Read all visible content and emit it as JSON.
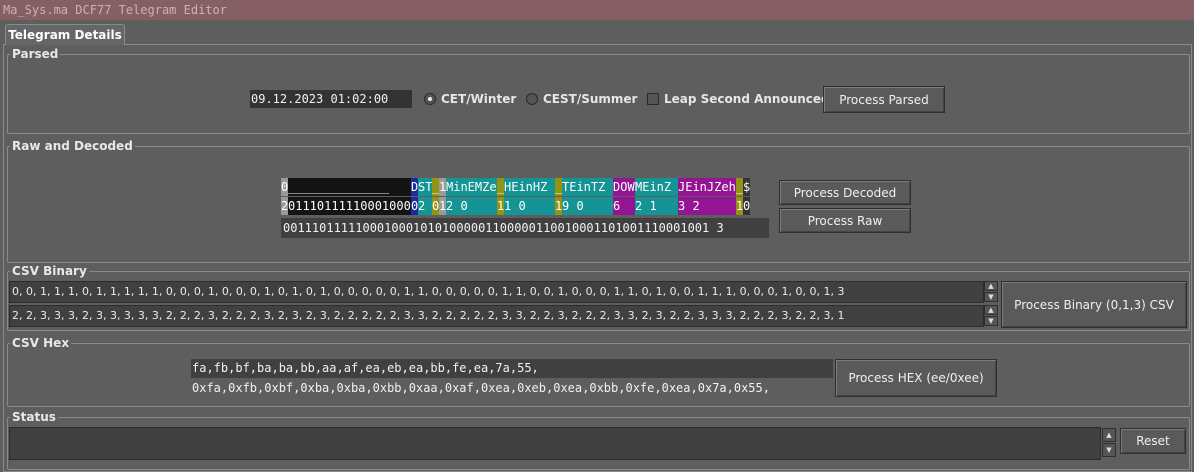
{
  "window": {
    "title": "Ma_Sys.ma DCF77 Telegram Editor"
  },
  "tabs": [
    {
      "label": "Telegram Details"
    }
  ],
  "parsed": {
    "title": "Parsed",
    "datetime_value": "09.12.2023 01:02:00",
    "radio_cet": "CET/Winter",
    "radio_cest": "CEST/Summer",
    "selected": "CET/Winter",
    "leap_label": "Leap Second Announced",
    "leap_checked": false,
    "process_button": "Process Parsed"
  },
  "raw_decoded": {
    "title": "Raw and Decoded",
    "decoded_button": "Process Decoded",
    "raw_button": "Process Raw",
    "segments": [
      {
        "h": "0",
        "v": "2",
        "color": "#9a9a9a"
      },
      {
        "h": "______________",
        "v": "01110111110001000",
        "color": "#141414"
      },
      {
        "h": "D",
        "v": "0",
        "color": "#1c2c9c"
      },
      {
        "h": "ST",
        "v": "2",
        "color": "#149494"
      },
      {
        "h": "_",
        "v": "0",
        "color": "#949414"
      },
      {
        "h": "1",
        "v": "1",
        "color": "#9a9a9a"
      },
      {
        "h": "MinEMZe",
        "v": "2     0",
        "color": "#149494"
      },
      {
        "h": "_",
        "v": "1",
        "color": "#949414"
      },
      {
        "h": "HEinHZ",
        "v": "1     0",
        "color": "#149494"
      },
      {
        "h": "_",
        "v": "1",
        "color": "#949414"
      },
      {
        "h": "TEinTZ",
        "v": "9     0",
        "color": "#149494"
      },
      {
        "h": "DOW",
        "v": "6",
        "color": "#941494"
      },
      {
        "h": "MEinZ",
        "v": "2    1",
        "color": "#149494"
      },
      {
        "h": "JEinJZeh",
        "v": "3   2",
        "color": "#941494"
      },
      {
        "h": "_",
        "v": "1",
        "color": "#949414"
      },
      {
        "h": "$",
        "v": "0",
        "color": "#333333"
      }
    ],
    "raw_bits": "00111011111000100010101000001100000110010001101001110001001 3"
  },
  "csv_binary": {
    "title": "CSV Binary",
    "line1": "0, 0, 1, 1, 1, 0, 1, 1, 1, 1, 1, 0, 0, 0, 1, 0, 0, 0, 1, 0, 1, 0, 1, 0, 0, 0, 0, 0, 1, 1, 0, 0, 0, 0, 0, 1, 1, 0, 0, 1, 0, 0, 0, 1, 1, 0, 1, 0, 0, 1, 1, 1, 0, 0, 0, 1, 0, 0, 1, 3",
    "line2": "2, 2, 3, 3, 3, 2, 3, 3, 3, 3, 3, 2, 2, 2, 3, 2, 2, 2, 3, 2, 3, 2, 3, 2, 2, 2, 2, 2, 3, 3, 2, 2, 2, 2, 2, 3, 3, 2, 2, 3, 2, 2, 2, 3, 3, 2, 3, 2, 2, 3, 3, 3, 2, 2, 2, 3, 2, 2, 3, 1",
    "process_button": "Process Binary (0,1,3) CSV"
  },
  "csv_hex": {
    "title": "CSV Hex",
    "line1": "fa,fb,bf,ba,ba,bb,aa,af,ea,eb,ea,bb,fe,ea,7a,55,",
    "line2": "0xfa,0xfb,0xbf,0xba,0xba,0xbb,0xaa,0xaf,0xea,0xeb,0xea,0xbb,0xfe,0xea,0x7a,0x55,",
    "process_button": "Process HEX (ee/0xee)"
  },
  "status": {
    "title": "Status",
    "text": "",
    "reset_button": "Reset"
  },
  "colors": {
    "title_bar": "#855f64",
    "background": "#5e5e5e",
    "field_dark": "#333333"
  }
}
